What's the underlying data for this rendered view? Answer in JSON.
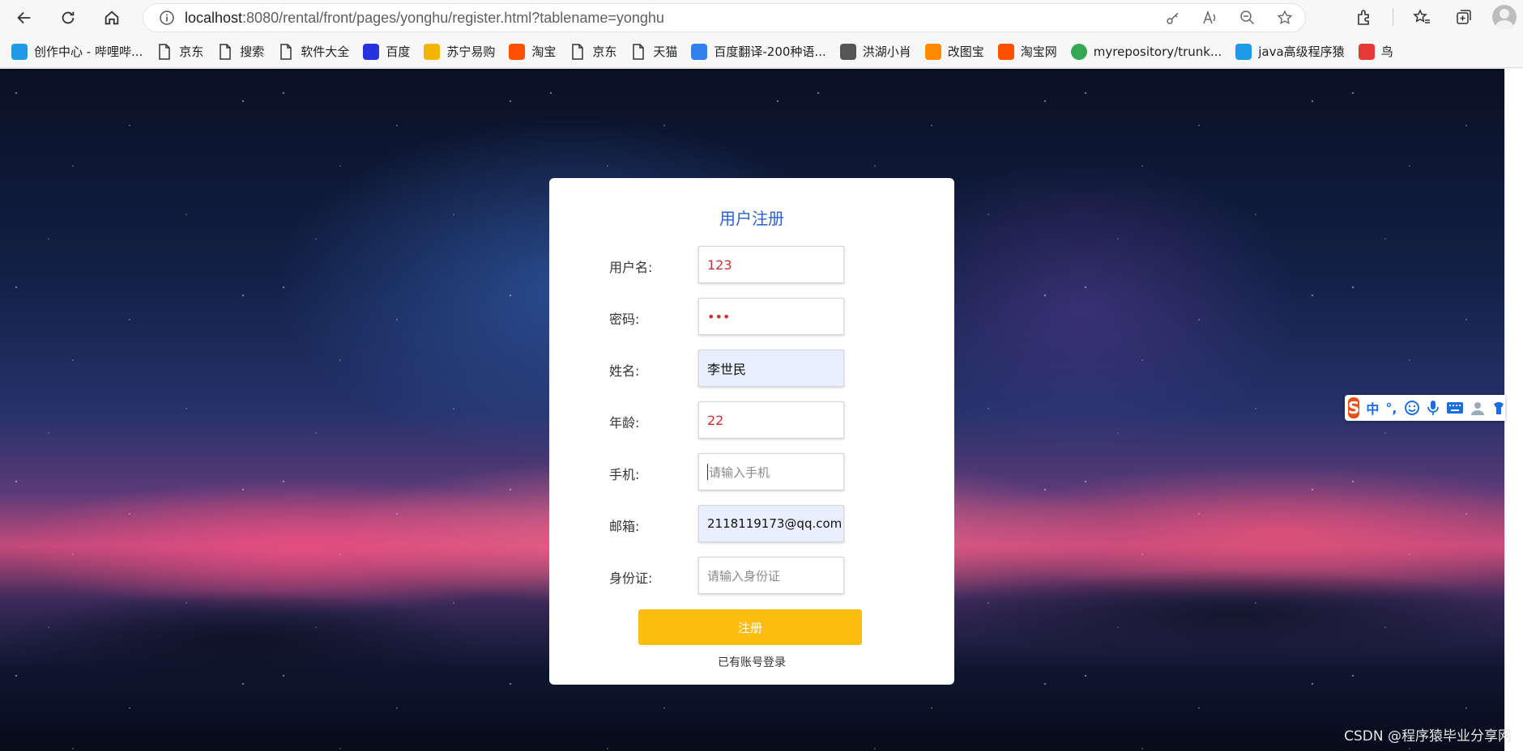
{
  "browser": {
    "url_host": "localhost",
    "url_rest": ":8080/rental/front/pages/yonghu/register.html?tablename=yonghu"
  },
  "bookmarks": [
    {
      "label": "创作中心 - 哔哩哔...",
      "icon": "bilibili-icon",
      "color": "#1e9be6"
    },
    {
      "label": "京东",
      "icon": "page-icon",
      "color": ""
    },
    {
      "label": "搜索",
      "icon": "page-icon",
      "color": ""
    },
    {
      "label": "软件大全",
      "icon": "page-icon",
      "color": ""
    },
    {
      "label": "百度",
      "icon": "baidu-paw-icon",
      "color": "#2932e1"
    },
    {
      "label": "苏宁易购",
      "icon": "suning-icon",
      "color": "#f4b400"
    },
    {
      "label": "淘宝",
      "icon": "taobao-icon",
      "color": "#ff5000"
    },
    {
      "label": "京东",
      "icon": "page-icon",
      "color": ""
    },
    {
      "label": "天猫",
      "icon": "page-icon",
      "color": ""
    },
    {
      "label": "百度翻译-200种语...",
      "icon": "translate-icon",
      "color": "#2f80ed"
    },
    {
      "label": "洪湖小肖",
      "icon": "bird-icon",
      "color": "#555555"
    },
    {
      "label": "改图宝",
      "icon": "gaitubao-icon",
      "color": "#ff8a00"
    },
    {
      "label": "淘宝网",
      "icon": "taobao-icon",
      "color": "#ff5000"
    },
    {
      "label": "myrepository/trunk...",
      "icon": "chrome-icon",
      "color": "#34a853"
    },
    {
      "label": "java高级程序猿",
      "icon": "bilibili-icon",
      "color": "#1e9be6"
    },
    {
      "label": "鸟",
      "icon": "red-bird-icon",
      "color": "#e53935"
    }
  ],
  "form": {
    "title": "用户注册",
    "fields": [
      {
        "label": "用户名:",
        "value": "123",
        "placeholder": ""
      },
      {
        "label": "密码:",
        "value": "•••",
        "placeholder": ""
      },
      {
        "label": "姓名:",
        "value": "李世民",
        "placeholder": ""
      },
      {
        "label": "年龄:",
        "value": "22",
        "placeholder": ""
      },
      {
        "label": "手机:",
        "value": "",
        "placeholder": "请输入手机"
      },
      {
        "label": "邮箱:",
        "value": "2118119173@qq.com",
        "placeholder": ""
      },
      {
        "label": "身份证:",
        "value": "",
        "placeholder": "请输入身份证"
      }
    ],
    "submit_label": "注册",
    "login_link": "已有账号登录"
  },
  "ime": {
    "mode": "中",
    "punct": "°,"
  },
  "watermark": "CSDN @程序猿毕业分享网",
  "colors": {
    "accent": "#2b5fd9",
    "submit": "#fcbd0f",
    "value_text": "#d03030"
  }
}
